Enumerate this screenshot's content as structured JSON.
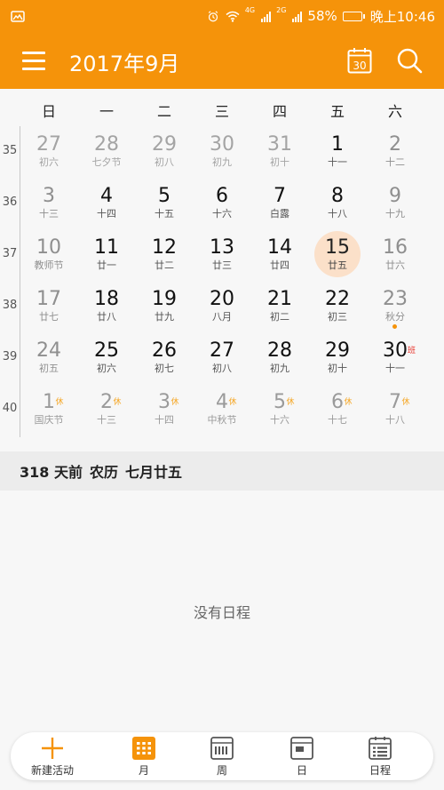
{
  "status_bar": {
    "battery": "58%",
    "time": "晚上10:46",
    "net1": "4G",
    "net2": "2G",
    "battery_level": 0.58
  },
  "header": {
    "title": "2017年9月",
    "today_icon_text": "30",
    "menu_icon": "menu-icon",
    "today_icon": "calendar-today-icon",
    "search_icon": "search-icon"
  },
  "weekdays": [
    "日",
    "一",
    "二",
    "三",
    "四",
    "五",
    "六"
  ],
  "week_numbers": [
    "35",
    "36",
    "37",
    "38",
    "39",
    "40"
  ],
  "weeks": [
    [
      {
        "day": "27",
        "lunar": "初六",
        "type": "other"
      },
      {
        "day": "28",
        "lunar": "七夕节",
        "type": "other"
      },
      {
        "day": "29",
        "lunar": "初八",
        "type": "other"
      },
      {
        "day": "30",
        "lunar": "初九",
        "type": "other"
      },
      {
        "day": "31",
        "lunar": "初十",
        "type": "other"
      },
      {
        "day": "1",
        "lunar": "十一",
        "type": "normal"
      },
      {
        "day": "2",
        "lunar": "十二",
        "type": "weekend"
      }
    ],
    [
      {
        "day": "3",
        "lunar": "十三",
        "type": "weekend"
      },
      {
        "day": "4",
        "lunar": "十四",
        "type": "normal"
      },
      {
        "day": "5",
        "lunar": "十五",
        "type": "normal"
      },
      {
        "day": "6",
        "lunar": "十六",
        "type": "normal"
      },
      {
        "day": "7",
        "lunar": "白露",
        "type": "normal"
      },
      {
        "day": "8",
        "lunar": "十八",
        "type": "normal"
      },
      {
        "day": "9",
        "lunar": "十九",
        "type": "weekend"
      }
    ],
    [
      {
        "day": "10",
        "lunar": "教师节",
        "type": "weekend"
      },
      {
        "day": "11",
        "lunar": "廿一",
        "type": "normal"
      },
      {
        "day": "12",
        "lunar": "廿二",
        "type": "normal"
      },
      {
        "day": "13",
        "lunar": "廿三",
        "type": "normal"
      },
      {
        "day": "14",
        "lunar": "廿四",
        "type": "normal"
      },
      {
        "day": "15",
        "lunar": "廿五",
        "type": "selected"
      },
      {
        "day": "16",
        "lunar": "廿六",
        "type": "weekend"
      }
    ],
    [
      {
        "day": "17",
        "lunar": "廿七",
        "type": "weekend"
      },
      {
        "day": "18",
        "lunar": "廿八",
        "type": "normal"
      },
      {
        "day": "19",
        "lunar": "廿九",
        "type": "normal"
      },
      {
        "day": "20",
        "lunar": "八月",
        "type": "normal"
      },
      {
        "day": "21",
        "lunar": "初二",
        "type": "normal"
      },
      {
        "day": "22",
        "lunar": "初三",
        "type": "normal"
      },
      {
        "day": "23",
        "lunar": "秋分",
        "type": "weekend",
        "event": true
      }
    ],
    [
      {
        "day": "24",
        "lunar": "初五",
        "type": "weekend"
      },
      {
        "day": "25",
        "lunar": "初六",
        "type": "normal"
      },
      {
        "day": "26",
        "lunar": "初七",
        "type": "normal"
      },
      {
        "day": "27",
        "lunar": "初八",
        "type": "normal"
      },
      {
        "day": "28",
        "lunar": "初九",
        "type": "normal"
      },
      {
        "day": "29",
        "lunar": "初十",
        "type": "normal"
      },
      {
        "day": "30",
        "lunar": "十一",
        "type": "normal",
        "badge": "班",
        "badge_type": "work"
      }
    ],
    [
      {
        "day": "1",
        "lunar": "国庆节",
        "type": "holiday",
        "badge": "休",
        "badge_type": "rest"
      },
      {
        "day": "2",
        "lunar": "十三",
        "type": "holiday",
        "badge": "休",
        "badge_type": "rest"
      },
      {
        "day": "3",
        "lunar": "十四",
        "type": "holiday",
        "badge": "休",
        "badge_type": "rest"
      },
      {
        "day": "4",
        "lunar": "中秋节",
        "type": "holiday",
        "badge": "休",
        "badge_type": "rest"
      },
      {
        "day": "5",
        "lunar": "十六",
        "type": "holiday",
        "badge": "休",
        "badge_type": "rest"
      },
      {
        "day": "6",
        "lunar": "十七",
        "type": "holiday",
        "badge": "休",
        "badge_type": "rest"
      },
      {
        "day": "7",
        "lunar": "十八",
        "type": "holiday",
        "badge": "休",
        "badge_type": "rest"
      }
    ]
  ],
  "info": {
    "days_ago": "318 天前",
    "lunar_label": "农历",
    "lunar_date": "七月廿五"
  },
  "empty_message": "没有日程",
  "bottom_nav": [
    {
      "label": "新建活动",
      "icon": "plus-icon"
    },
    {
      "label": "月",
      "icon": "month-view-icon",
      "active": true
    },
    {
      "label": "周",
      "icon": "week-view-icon"
    },
    {
      "label": "日",
      "icon": "day-view-icon"
    },
    {
      "label": "日程",
      "icon": "agenda-icon"
    }
  ],
  "colors": {
    "accent": "#f5930a",
    "selected_bg": "#fbe0c9",
    "rest_badge": "#f5a623",
    "work_badge": "#e8332a"
  }
}
